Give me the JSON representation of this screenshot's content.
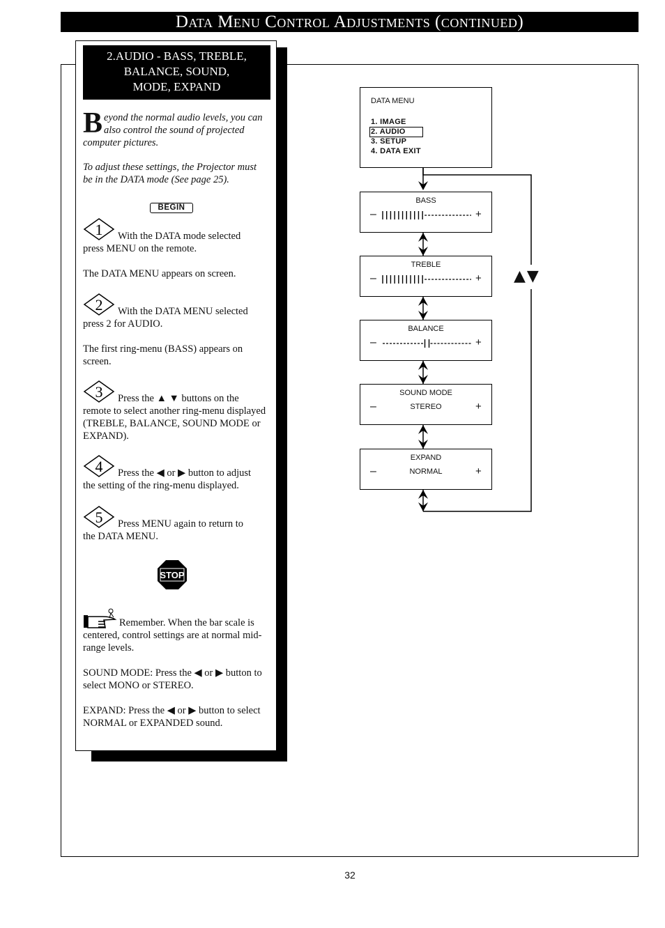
{
  "header": {
    "title": "Data Menu Control Adjustments (continued)"
  },
  "section": {
    "heading_line1": "2.AUDIO - BASS, TREBLE,",
    "heading_line2": "BALANCE, SOUND,",
    "heading_line3": "MODE, EXPAND",
    "intro_drop_cap": "B",
    "intro_line1": "eyond the normal audio levels, you can",
    "intro_line2": "also control the sound of projected",
    "intro_line3": "computer pictures.",
    "note": "To adjust these settings, the Projector must be in the DATA mode (See page 25).",
    "begin_label": "BEGIN",
    "steps": [
      {
        "number": "1",
        "lead": "With the DATA mode selected",
        "rest": "press MENU on the remote.",
        "result": "The DATA MENU appears on screen."
      },
      {
        "number": "2",
        "lead": "With the DATA MENU selected",
        "rest": "press 2 for AUDIO.",
        "result": "The first ring-menu (BASS) appears on screen."
      },
      {
        "number": "3",
        "lead": "Press the ▲ ▼ buttons on the",
        "rest": "remote to select another ring-menu displayed (TREBLE, BALANCE, SOUND MODE or EXPAND).",
        "result": ""
      },
      {
        "number": "4",
        "lead": "Press the ◀ or ▶ button to adjust",
        "rest": "the setting of the ring-menu displayed.",
        "result": ""
      },
      {
        "number": "5",
        "lead": "Press MENU again to return to",
        "rest": "the DATA MENU.",
        "result": ""
      }
    ],
    "stop_label": "STOP",
    "remember_lead": "Remember. When the bar scale is",
    "remember_rest": "centered, control settings are at normal mid-range levels.",
    "sound_mode_note": "SOUND MODE: Press the ◀ or ▶ button to select MONO or STEREO.",
    "expand_note": "EXPAND: Press the ◀ or ▶ button to select NORMAL or EXPANDED sound."
  },
  "diagram": {
    "data_menu": {
      "title": "DATA MENU",
      "items": [
        "1. IMAGE",
        "2. AUDIO",
        "3. SETUP",
        "4. DATA EXIT"
      ],
      "selected_index": 1
    },
    "ring_menus": [
      {
        "label": "BASS",
        "type": "bar",
        "level": 0.45,
        "minus": "–",
        "plus": "+"
      },
      {
        "label": "TREBLE",
        "type": "bar",
        "level": 0.45,
        "minus": "–",
        "plus": "+"
      },
      {
        "label": "BALANCE",
        "type": "balance",
        "level": 0.5,
        "minus": "–",
        "plus": "+"
      },
      {
        "label": "SOUND MODE",
        "type": "value",
        "value": "STEREO",
        "minus": "–",
        "plus": "+"
      },
      {
        "label": "EXPAND",
        "type": "value",
        "value": "NORMAL",
        "minus": "–",
        "plus": "+"
      }
    ],
    "nav_arrows": "▲▼"
  },
  "footer": {
    "page_number": "32"
  }
}
